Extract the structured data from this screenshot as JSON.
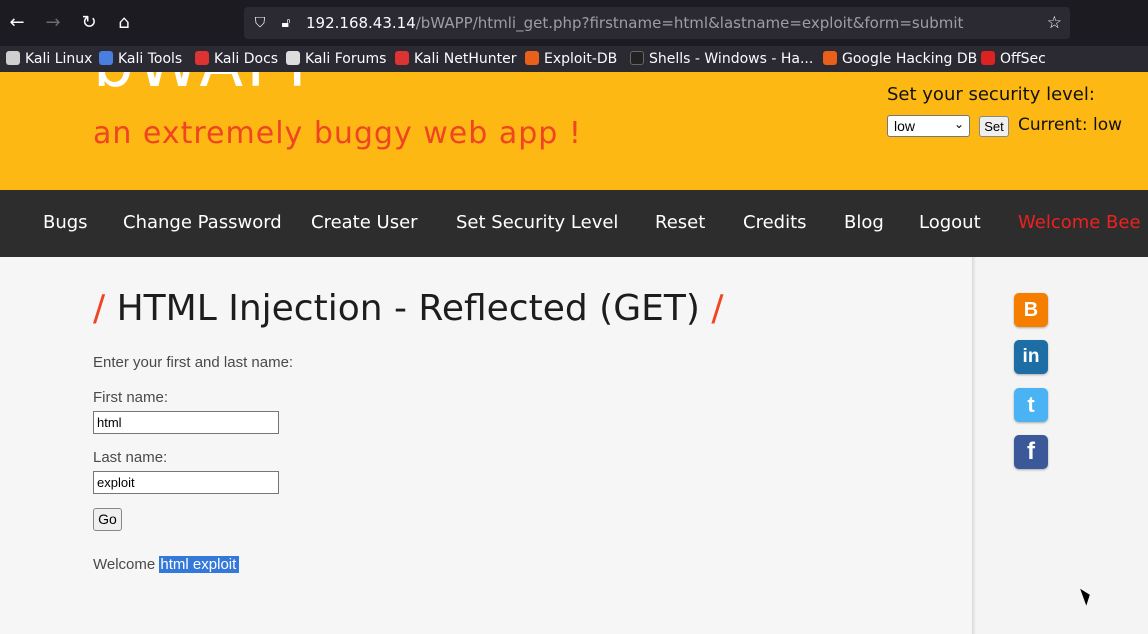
{
  "browser": {
    "url_host": "192.168.43.14",
    "url_path": "/bWAPP/htmli_get.php?firstname=html&lastname=exploit&form=submit",
    "bookmarks": [
      {
        "label": "Kali Linux",
        "color": "#cfcfcf"
      },
      {
        "label": "Kali Tools",
        "color": "#4a7fe0"
      },
      {
        "label": "Kali Docs",
        "color": "#d33"
      },
      {
        "label": "Kali Forums",
        "color": "#ddd"
      },
      {
        "label": "Kali NetHunter",
        "color": "#d33"
      },
      {
        "label": "Exploit-DB",
        "color": "#e8601c"
      },
      {
        "label": "Shells - Windows - Ha...",
        "color": "#222"
      },
      {
        "label": "Google Hacking DB",
        "color": "#e8601c"
      },
      {
        "label": "OffSec",
        "color": "#d22"
      }
    ]
  },
  "header": {
    "logo": "bWAPP",
    "tagline": "an extremely buggy web app !",
    "security_label": "Set your security level:",
    "security_value": "low",
    "set_button": "Set",
    "current_label": "Current:",
    "current_value": "low"
  },
  "menu": [
    "Bugs",
    "Change Password",
    "Create User",
    "Set Security Level",
    "Reset",
    "Credits",
    "Blog",
    "Logout",
    "Welcome Bee"
  ],
  "main": {
    "title": "HTML Injection - Reflected (GET)",
    "title_slash": "/",
    "intro": "Enter your first and last name:",
    "first_label": "First name:",
    "first_value": "html",
    "last_label": "Last name:",
    "last_value": "exploit",
    "go_button": "Go",
    "welcome_prefix": "Welcome",
    "welcome_name": "html exploit"
  },
  "social": [
    {
      "name": "blogger",
      "glyph": "B",
      "color": "#f57d00"
    },
    {
      "name": "linkedin",
      "glyph": "in",
      "color": "#1c6ea4"
    },
    {
      "name": "twitter",
      "glyph": "t",
      "color": "#4ab3f4"
    },
    {
      "name": "facebook",
      "glyph": "f",
      "color": "#3b5998"
    }
  ]
}
